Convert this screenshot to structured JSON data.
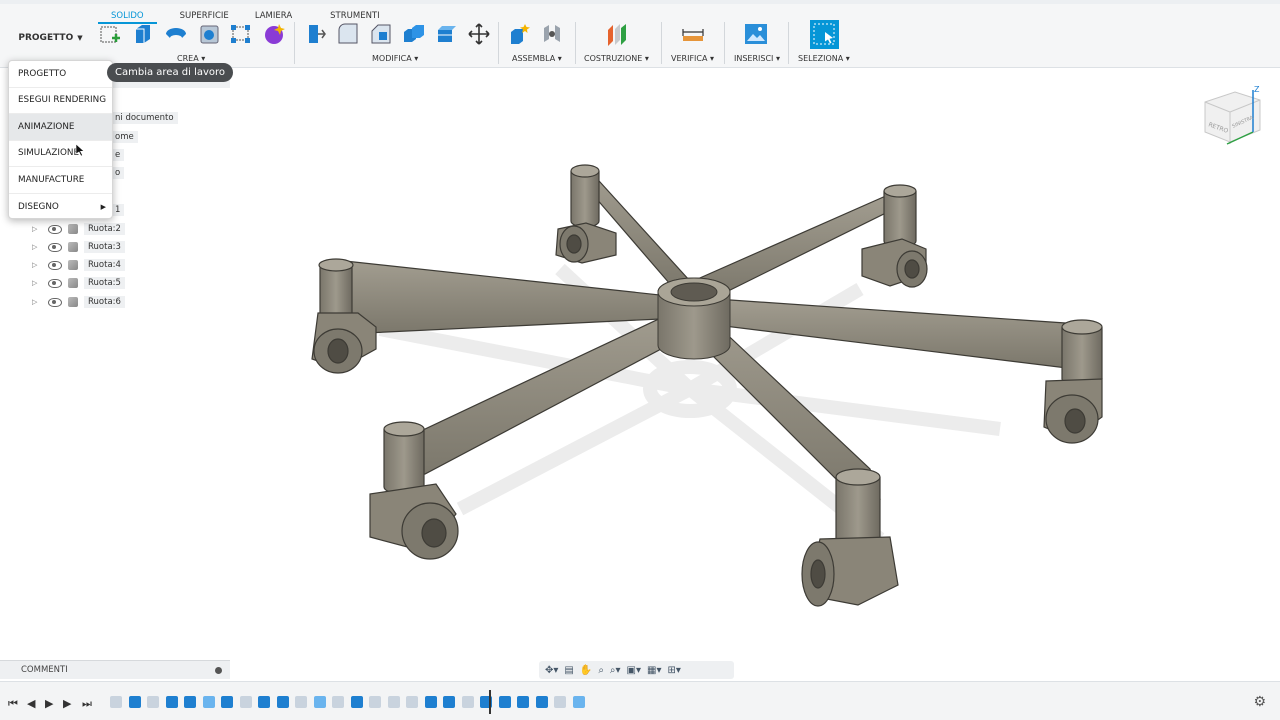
{
  "toolbar": {
    "workspace_label": "PROGETTO",
    "tabs": [
      "SOLIDO",
      "SUPERFICIE",
      "LAMIERA",
      "STRUMENTI"
    ],
    "active_tab": "SOLIDO",
    "groups": {
      "crea": "CREA",
      "modifica": "MODIFICA",
      "assembla": "ASSEMBLA",
      "costruzione": "COSTRUZIONE",
      "verifica": "VERIFICA",
      "inserisci": "INSERISCI",
      "seleziona": "SELEZIONA"
    },
    "accent": "#0696d7"
  },
  "workspace_menu": {
    "items": [
      {
        "label": "PROGETTO"
      },
      {
        "label": "ESEGUI RENDERING"
      },
      {
        "label": "ANIMAZIONE"
      },
      {
        "label": "SIMULAZIONE"
      },
      {
        "label": "MANUFACTURE"
      },
      {
        "label": "DISEGNO"
      }
    ],
    "highlighted": "ANIMAZIONE"
  },
  "tooltip": "Cambia area di lavoro",
  "browser": {
    "fragments": [
      "ni documento",
      "ome",
      "e",
      "o",
      "1"
    ],
    "rows": [
      {
        "label": "Ruota:2"
      },
      {
        "label": "Ruota:3"
      },
      {
        "label": "Ruota:4"
      },
      {
        "label": "Ruota:5"
      },
      {
        "label": "Ruota:6"
      }
    ]
  },
  "comments_label": "COMMENTI",
  "viewcube": {
    "face_front": "RETRO",
    "face_side": "SINISTRA",
    "axis_z": "Z"
  },
  "model_color": "#8c8779"
}
